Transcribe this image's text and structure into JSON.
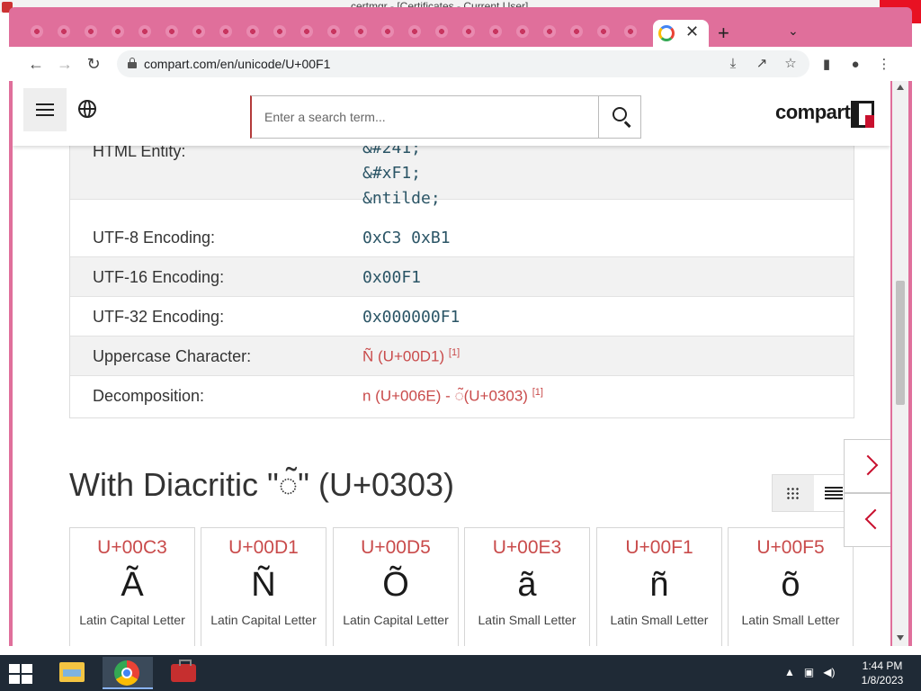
{
  "desktop": {
    "behind_window_title": "certmgr - [Certificates - Current User]"
  },
  "browser": {
    "url": "compart.com/en/unicode/U+00F1",
    "new_tab_symbol": "+",
    "close_tab_symbol": "✕",
    "tab_menu_symbol": "⌄"
  },
  "site": {
    "search_placeholder": "Enter a search term...",
    "logo_text": "compart"
  },
  "info_rows": [
    {
      "label": "HTML Entity:",
      "values": [
        "&#241;",
        "&#xF1;",
        "&ntilde;"
      ]
    },
    {
      "label": "UTF-8 Encoding:",
      "value": "0xC3 0xB1"
    },
    {
      "label": "UTF-16 Encoding:",
      "value": "0x00F1"
    },
    {
      "label": "UTF-32 Encoding:",
      "value": "0x000000F1"
    },
    {
      "label": "Uppercase Character:",
      "value": "Ñ (U+00D1)",
      "ref": "[1]"
    },
    {
      "label": "Decomposition:",
      "value": "n (U+006E) - ◌̃(U+0303)",
      "ref": "[1]"
    }
  ],
  "diacritic_section": {
    "heading": "With Diacritic \"◌̃\" (U+0303)",
    "cards": [
      {
        "code": "U+00C3",
        "glyph": "Ã",
        "name": "Latin Capital Letter"
      },
      {
        "code": "U+00D1",
        "glyph": "Ñ",
        "name": "Latin Capital Letter"
      },
      {
        "code": "U+00D5",
        "glyph": "Õ",
        "name": "Latin Capital Letter"
      },
      {
        "code": "U+00E3",
        "glyph": "ã",
        "name": "Latin Small Letter"
      },
      {
        "code": "U+00F1",
        "glyph": "ñ",
        "name": "Latin Small Letter"
      },
      {
        "code": "U+00F5",
        "glyph": "õ",
        "name": "Latin Small Letter"
      }
    ]
  },
  "taskbar": {
    "time": "1:44 PM",
    "date": "1/8/2023"
  },
  "colors": {
    "accent_red": "#c8102e",
    "tab_strip": "#e06f9b",
    "link_red": "#c94b4b"
  }
}
